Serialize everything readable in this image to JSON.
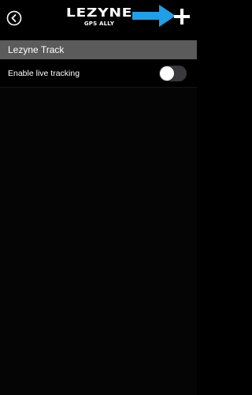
{
  "header": {
    "logo_wordmark": "LEZYNE",
    "logo_subtitle": "GPS ALLY",
    "back_icon": "chevron-left-circle-icon",
    "add_icon": "plus-icon",
    "annotation_arrow_icon": "arrow-right-icon",
    "annotation_color": "#1e9fe6"
  },
  "section": {
    "title": "Lezyne Track"
  },
  "settings": {
    "live_tracking": {
      "label": "Enable live tracking",
      "enabled": false
    }
  },
  "colors": {
    "background": "#000000",
    "section_header": "#5b5b5b",
    "toggle_off": "#39393d",
    "text": "#ffffff"
  }
}
